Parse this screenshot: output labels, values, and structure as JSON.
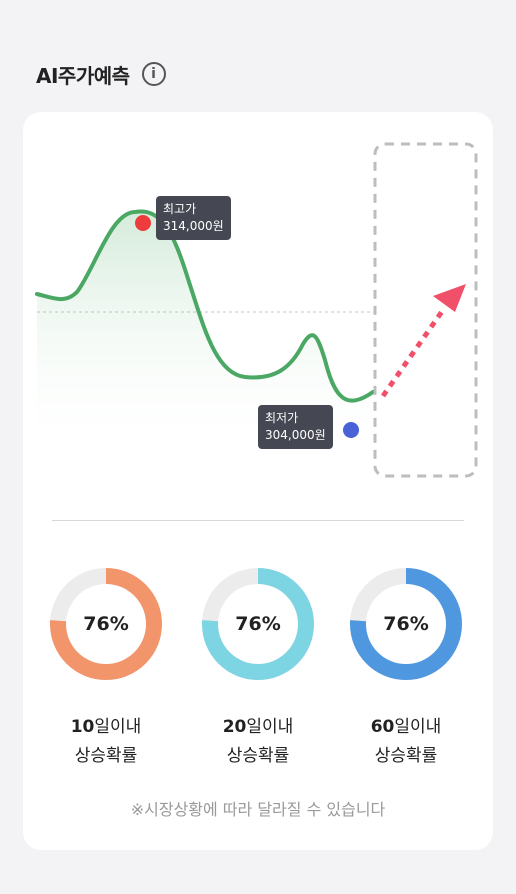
{
  "header": {
    "title": "AI주가예측",
    "info_icon": "info-icon",
    "info_glyph": "i"
  },
  "chart": {
    "high": {
      "label": "최고가",
      "value": "314,000원"
    },
    "low": {
      "label": "최저가",
      "value": "304,000원"
    },
    "colors": {
      "line": "#4aa864",
      "high_dot": "#ee3b3b",
      "low_dot": "#4a62d8",
      "arrow": "#f0506a",
      "forecast_box": "#bdbdbd"
    }
  },
  "predictions": [
    {
      "percent": "76%",
      "value": 0.76,
      "days": "10",
      "days_suffix": "일이내",
      "desc": "상승확률",
      "color": "#f2956b"
    },
    {
      "percent": "76%",
      "value": 0.76,
      "days": "20",
      "days_suffix": "일이내",
      "desc": "상승확률",
      "color": "#7dd4e2"
    },
    {
      "percent": "76%",
      "value": 0.76,
      "days": "60",
      "days_suffix": "일이내",
      "desc": "상승확률",
      "color": "#4f98df"
    }
  ],
  "footer": {
    "note": "※시장상황에 따라 달라질 수 있습니다"
  }
}
